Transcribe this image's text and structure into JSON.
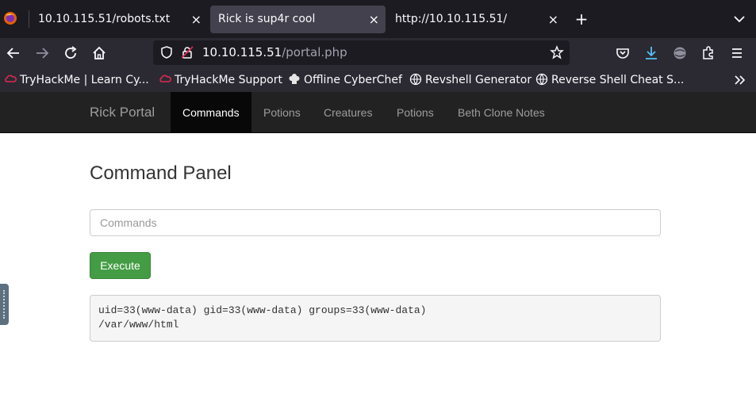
{
  "tabs": [
    {
      "title": "10.10.115.51/robots.txt",
      "active": false
    },
    {
      "title": "Rick is sup4r cool",
      "active": true
    },
    {
      "title": "http://10.10.115.51/",
      "active": false
    }
  ],
  "tab_close_glyph": "×",
  "new_tab_glyph": "+",
  "url": {
    "host": "10.10.115.51",
    "path": "/portal.php"
  },
  "bookmarks": [
    {
      "label": "TryHackMe | Learn Cy...",
      "icon": "tryhackme-icon"
    },
    {
      "label": "TryHackMe Support",
      "icon": "tryhackme-icon"
    },
    {
      "label": "Offline CyberChef",
      "icon": "chef-hat-icon"
    },
    {
      "label": "Revshell Generator",
      "icon": "globe-icon"
    },
    {
      "label": "Reverse Shell Cheat S...",
      "icon": "globe-icon"
    }
  ],
  "site": {
    "brand": "Rick Portal",
    "nav": [
      {
        "label": "Commands",
        "active": true
      },
      {
        "label": "Potions",
        "active": false
      },
      {
        "label": "Creatures",
        "active": false
      },
      {
        "label": "Potions",
        "active": false
      },
      {
        "label": "Beth Clone Notes",
        "active": false
      }
    ]
  },
  "panel": {
    "title": "Command Panel",
    "input_placeholder": "Commands",
    "input_value": "",
    "execute_label": "Execute",
    "output": "uid=33(www-data) gid=33(www-data) groups=33(www-data)\n/var/www/html"
  },
  "colors": {
    "execute_button": "#449d44",
    "navbar_bg": "#222222",
    "chrome_dark": "#1c1b22",
    "chrome_toolbar": "#2b2a33"
  }
}
